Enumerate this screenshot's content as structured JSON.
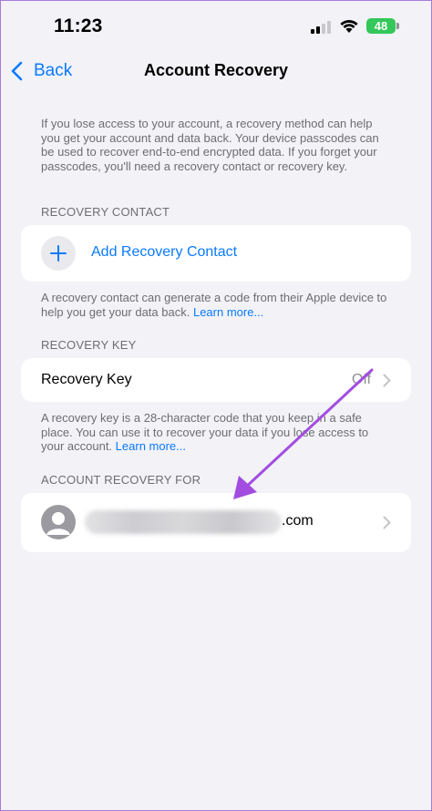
{
  "status_bar": {
    "time": "11:23",
    "battery": "48"
  },
  "nav": {
    "back_label": "Back",
    "title": "Account Recovery"
  },
  "intro_text": "If you lose access to your account, a recovery method can help you get your account and data back. Your device passcodes can be used to recover end-to-end encrypted data. If you forget your passcodes, you'll need a recovery contact or recovery key.",
  "recovery_contact": {
    "header": "RECOVERY CONTACT",
    "add_label": "Add Recovery Contact",
    "footer_text": "A recovery contact can generate a code from their Apple device to help you get your data back.",
    "learn_more": "Learn more..."
  },
  "recovery_key": {
    "header": "RECOVERY KEY",
    "row_label": "Recovery Key",
    "row_value": "Off",
    "footer_text": "A recovery key is a 28-character code that you keep in a safe place. You can use it to recover your data if you lose access to your account.",
    "learn_more": "Learn more..."
  },
  "account_for": {
    "header": "ACCOUNT RECOVERY FOR",
    "email_suffix": ".com"
  },
  "colors": {
    "accent": "#0a7aff",
    "background": "#f2f2f7",
    "annotation_arrow": "#a24de0"
  }
}
